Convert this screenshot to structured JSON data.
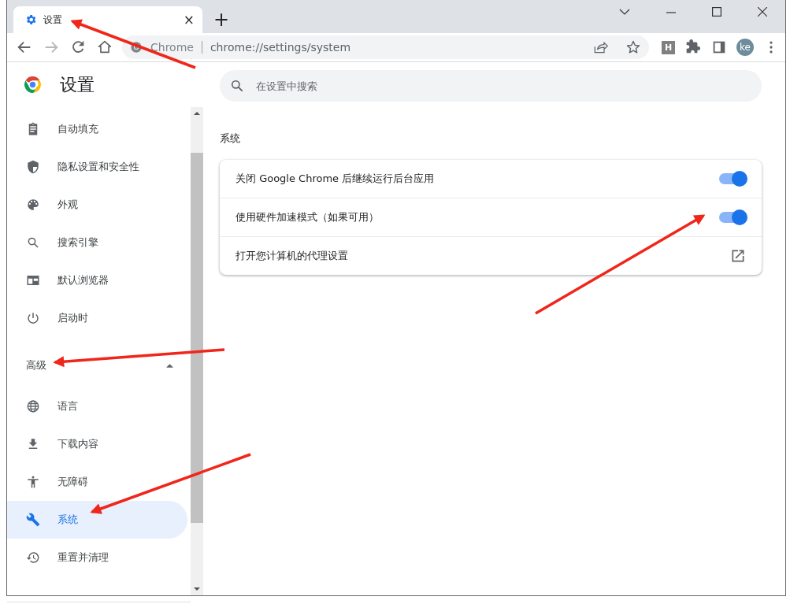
{
  "tab": {
    "title": "设置",
    "close": "×",
    "selected": true
  },
  "new_tab": "+",
  "address": {
    "site": "Chrome",
    "url": "chrome://settings/system"
  },
  "extension_badge": "H",
  "profile": "ke",
  "sidebar": {
    "title": "设置",
    "items": [
      {
        "label": "自动填充",
        "selected": false
      },
      {
        "label": "隐私设置和安全性",
        "selected": false
      },
      {
        "label": "外观",
        "selected": false
      },
      {
        "label": "搜索引擎",
        "selected": false
      },
      {
        "label": "默认浏览器",
        "selected": false
      },
      {
        "label": "启动时",
        "selected": false
      }
    ],
    "advanced": {
      "label": "高级",
      "expanded": true,
      "items": [
        {
          "label": "语言",
          "selected": false
        },
        {
          "label": "下载内容",
          "selected": false
        },
        {
          "label": "无障碍",
          "selected": false
        },
        {
          "label": "系统",
          "selected": true
        },
        {
          "label": "重置并清理",
          "selected": false
        }
      ]
    }
  },
  "search": {
    "placeholder": "在设置中搜索"
  },
  "section": {
    "title": "系统",
    "rows": [
      {
        "label": "关闭 Google Chrome 后继续运行后台应用",
        "kind": "toggle",
        "on": true
      },
      {
        "label": "使用硬件加速模式（如果可用）",
        "kind": "toggle",
        "on": true
      },
      {
        "label": "打开您计算机的代理设置",
        "kind": "link"
      }
    ]
  }
}
